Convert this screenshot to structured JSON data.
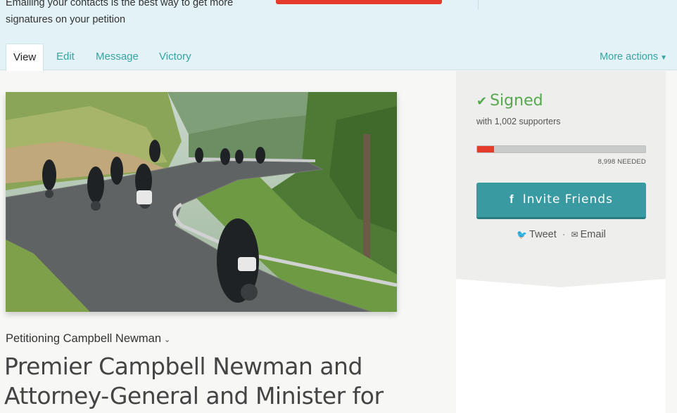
{
  "banner": {
    "text": "Emailing your contacts is the best way to get more signatures on your petition"
  },
  "tabs": [
    {
      "label": "View",
      "active": true
    },
    {
      "label": "Edit"
    },
    {
      "label": "Message"
    },
    {
      "label": "Victory"
    }
  ],
  "more_actions": {
    "label": "More actions",
    "icon": "caret-down-icon"
  },
  "photo": {
    "icon": "motorcycle-riders-photo"
  },
  "petition": {
    "petitioning_label": "Petitioning Campbell Newman",
    "title": "Premier Campbell Newman and Attorney-General and Minister for"
  },
  "sidebar": {
    "signed_label": "Signed",
    "supporters_text": "with 1,002 supporters",
    "progress_fraction": 0.1,
    "needed_text": "8,998 NEEDED",
    "invite_label": "Invite Friends",
    "invite_icon": "f",
    "tweet_label": "Tweet",
    "email_label": "Email",
    "separator": "·"
  },
  "colors": {
    "accent": "#36a3a3",
    "signed": "#56a84f",
    "progress": "#e53a2c",
    "invite_button": "#3a9aa1"
  }
}
